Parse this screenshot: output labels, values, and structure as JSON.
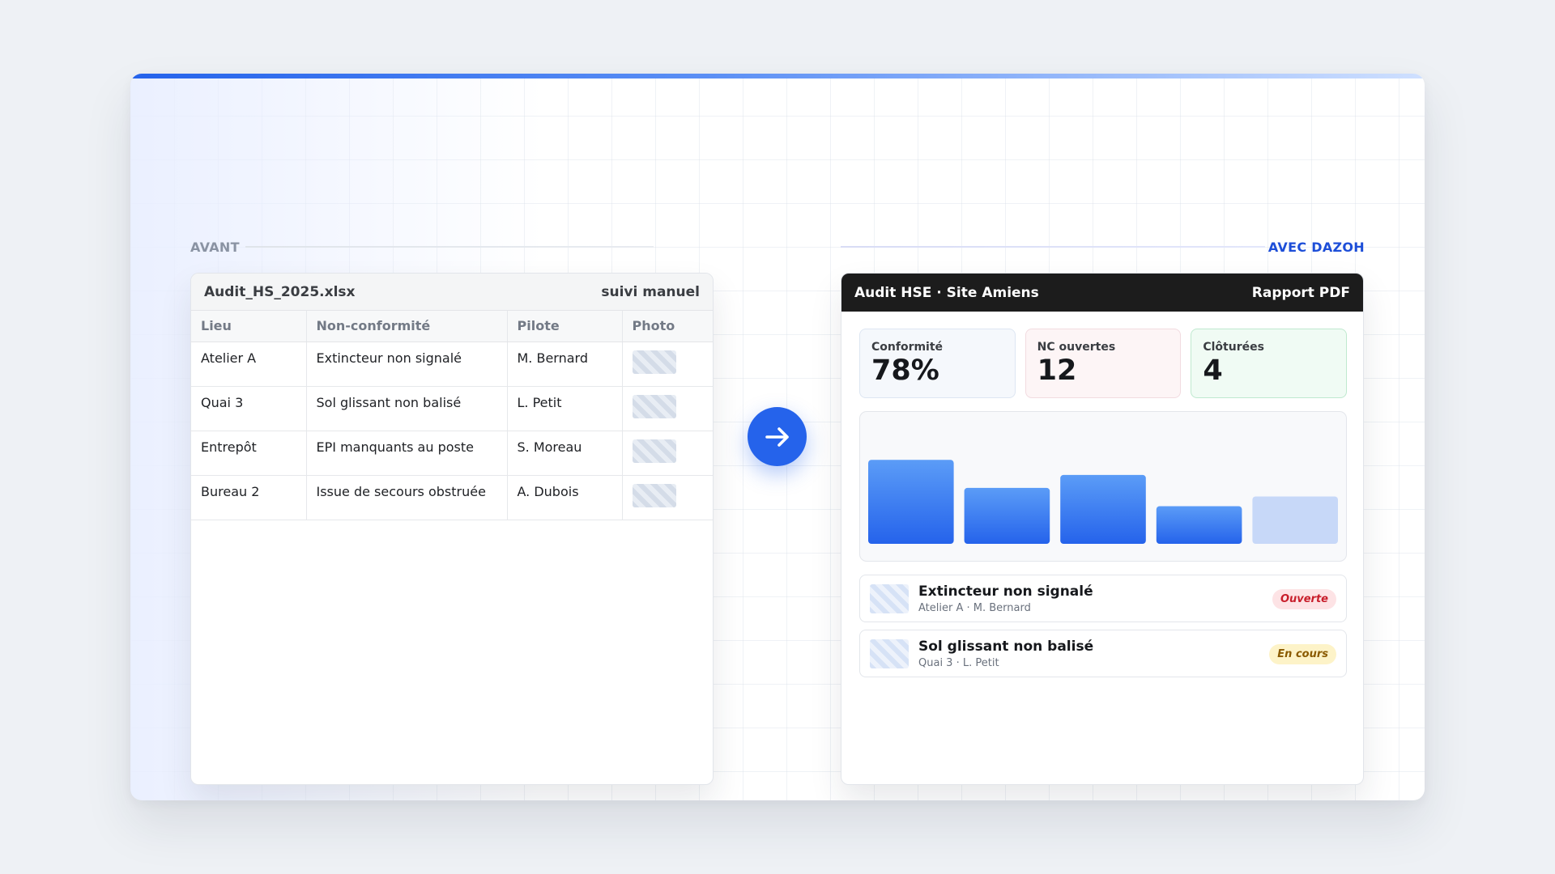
{
  "sections": {
    "before_label": "AVANT",
    "after_label": "AVEC DAZOH"
  },
  "spreadsheet": {
    "filename": "Audit_HS_2025.xlsx",
    "tag": "suivi manuel",
    "columns": [
      "Lieu",
      "Non-conformité",
      "Pilote",
      "Photo"
    ],
    "rows": [
      {
        "lieu": "Atelier A",
        "nc": "Extincteur non signalé",
        "pilote": "M. Bernard"
      },
      {
        "lieu": "Quai 3",
        "nc": "Sol glissant non balisé",
        "pilote": "L. Petit"
      },
      {
        "lieu": "Entrepôt",
        "nc": "EPI manquants au poste",
        "pilote": "S. Moreau"
      },
      {
        "lieu": "Bureau 2",
        "nc": "Issue de secours obstruée",
        "pilote": "A. Dubois"
      }
    ]
  },
  "arrow_icon": "arrow-right-icon",
  "dashboard": {
    "title": "Audit HSE · Site Amiens",
    "report_label": "Rapport PDF",
    "kpis": [
      {
        "label": "Conformité",
        "value": "78%"
      },
      {
        "label": "NC ouvertes",
        "value": "12"
      },
      {
        "label": "Clôturées",
        "value": "4"
      }
    ],
    "items": [
      {
        "title": "Extincteur non signalé",
        "subtitle": "Atelier A · M. Bernard",
        "status": "Ouverte"
      },
      {
        "title": "Sol glissant non balisé",
        "subtitle": "Quai 3 · L. Petit",
        "status": "En cours"
      }
    ]
  },
  "colors": {
    "accent": "#2563eb",
    "status_open": "#c81e2b",
    "status_in_progress": "#8a5a00"
  },
  "chart_data": {
    "type": "bar",
    "title": "",
    "xlabel": "",
    "ylabel": "",
    "categories": [],
    "values": [
      0.78,
      0.52,
      0.64,
      0.35,
      0.44
    ],
    "value_note": "relative bar heights, no axis shown",
    "ylim": [
      0,
      1
    ],
    "grid": false
  }
}
